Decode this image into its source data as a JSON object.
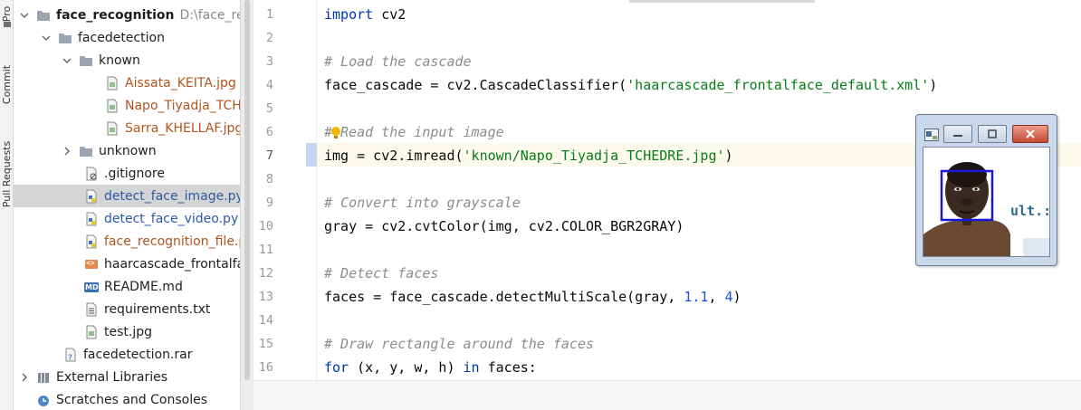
{
  "toolstrip": {
    "tabs": [
      "Pro",
      "Commit",
      "Pull Requests"
    ]
  },
  "project": {
    "root": {
      "name": "face_recognition",
      "path": "D:\\face_recog"
    },
    "items": [
      {
        "label": "facedetection"
      },
      {
        "label": "known"
      },
      {
        "label": "Aissata_KEITA.jpg"
      },
      {
        "label": "Napo_Tiyadja_TCHED"
      },
      {
        "label": "Sarra_KHELLAF.jpg"
      },
      {
        "label": "unknown"
      },
      {
        "label": ".gitignore"
      },
      {
        "label": "detect_face_image.py"
      },
      {
        "label": "detect_face_video.py"
      },
      {
        "label": "face_recognition_file.py"
      },
      {
        "label": "haarcascade_frontalface_"
      },
      {
        "label": "README.md"
      },
      {
        "label": "requirements.txt"
      },
      {
        "label": "test.jpg"
      },
      {
        "label": "facedetection.rar"
      },
      {
        "label": "External Libraries"
      },
      {
        "label": "Scratches and Consoles"
      }
    ],
    "badges": {
      "md": "MD",
      "xml": "<>"
    }
  },
  "editor": {
    "line_numbers": [
      "1",
      "2",
      "3",
      "4",
      "5",
      "6",
      "7",
      "8",
      "9",
      "10",
      "11",
      "12",
      "13",
      "14",
      "15",
      "16"
    ],
    "code": {
      "l1": {
        "kw": "import",
        "rest": " cv2"
      },
      "l3": "# Load the cascade",
      "l4": {
        "a": "face_cascade = cv2.CascadeClassifier(",
        "s": "'haarcascade_frontalface_default.xml'",
        "b": ")"
      },
      "l6": {
        "a": "#",
        "b": "Read the input image"
      },
      "l7": {
        "a": "img = cv2.imread(",
        "s": "'known/Napo_Tiyadja_TCHEDRE.jpg'",
        "b": ")"
      },
      "l9": "# Convert into grayscale",
      "l10": "gray = cv2.cvtColor(img, cv2.COLOR_BGR2GRAY)",
      "l12": "# Detect faces",
      "l13": {
        "a": "faces = face_cascade.detectMultiScale(gray, ",
        "n1": "1.1",
        "c": ", ",
        "n2": "4",
        "b": ")"
      },
      "l15": "# Draw rectangle around the faces",
      "l16": {
        "kw1": "for",
        "a": " (x, y, w, h) ",
        "kw2": "in",
        "b": " faces:"
      }
    }
  },
  "preview": {
    "overlay_text": "ult.:"
  },
  "colors": {
    "keyword": "#0033b3",
    "comment": "#8c8c8c",
    "string": "#067d17",
    "number": "#1750eb",
    "selected_row": "#d5d5d5",
    "current_line": "#fcfaed",
    "face_box": "#1a1ad6"
  },
  "icons": {
    "folder": "folder-icon",
    "image_file": "image-file-icon",
    "python_file": "python-file-icon",
    "text_file": "text-file-icon",
    "bulb": "lightbulb-icon"
  }
}
